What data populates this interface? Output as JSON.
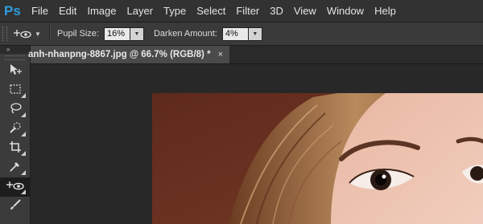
{
  "app": {
    "logo_text": "Ps"
  },
  "menu": [
    "File",
    "Edit",
    "Image",
    "Layer",
    "Type",
    "Select",
    "Filter",
    "3D",
    "View",
    "Window",
    "Help"
  ],
  "options": {
    "pupil_size_label": "Pupil Size:",
    "pupil_size_value": "16%",
    "darken_amount_label": "Darken Amount:",
    "darken_amount_value": "4%"
  },
  "toolbar": {
    "collapse_glyph": "»",
    "tools": [
      "move-icon",
      "marquee-icon",
      "lasso-icon",
      "quick-selection-icon",
      "crop-icon",
      "eyedropper-icon",
      "red-eye-icon",
      "brush-icon"
    ],
    "active_tool": "red-eye-icon"
  },
  "document": {
    "tab_title": "anh-nhanpng-8867.jpg @ 66.7% (RGB/8) *",
    "close_glyph": "×"
  },
  "colors": {
    "menubar": "#323232",
    "options_bar": "#3a3a3a",
    "workspace": "#282828",
    "photo_background": "#6b3020",
    "logo": "#2d9ee0"
  }
}
